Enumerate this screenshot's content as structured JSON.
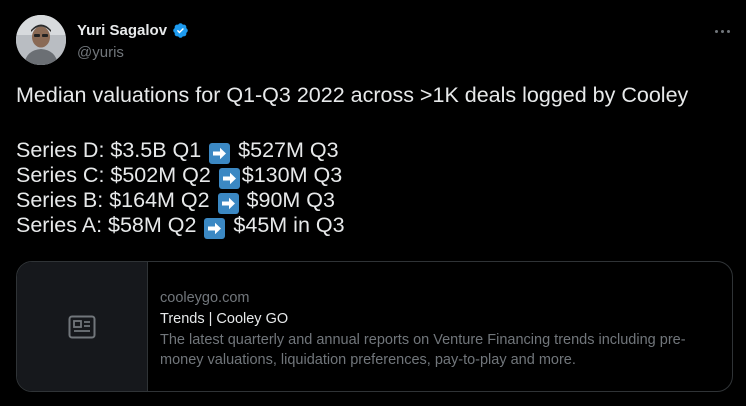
{
  "author": {
    "display_name": "Yuri Sagalov",
    "handle": "@yuris",
    "verified_icon": "verified-badge-icon"
  },
  "colors": {
    "background": "#000000",
    "text": "#e7e9ea",
    "muted": "#71767b",
    "verified": "#1d9bf0",
    "arrow_emoji": "#3b88c3",
    "card_border": "#2f3336"
  },
  "tweet": {
    "intro": "Median valuations for Q1-Q3 2022 across >1K deals logged by Cooley",
    "lines": [
      {
        "before": "Series D: $3.5B Q1 ",
        "after": " $527M Q3"
      },
      {
        "before": "Series C: $502M Q2 ",
        "after": "$130M Q3"
      },
      {
        "before": "Series B: $164M Q2 ",
        "after": " $90M Q3"
      },
      {
        "before": "Series A: $58M Q2 ",
        "after": " $45M in Q3"
      }
    ],
    "arrow_icon": "right-arrow-emoji-icon"
  },
  "link_card": {
    "domain": "cooleygo.com",
    "title": "Trends | Cooley GO",
    "description": "The latest quarterly and annual reports on Venture Financing trends including pre-money valuations, liquidation preferences, pay-to-play and more.",
    "media_icon": "article-icon"
  }
}
